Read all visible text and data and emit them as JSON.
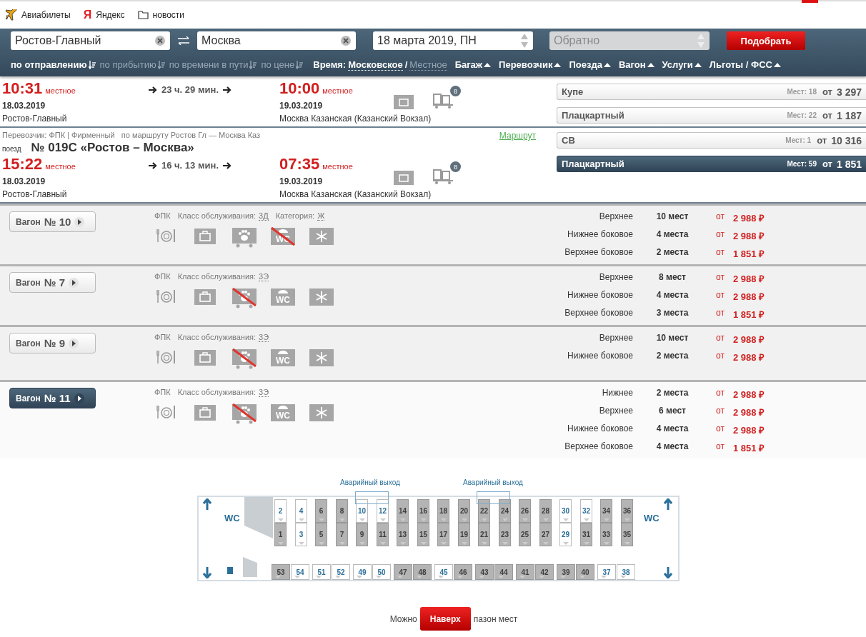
{
  "bookmarks": [
    {
      "kind": "plane",
      "label": "Авиабилеты"
    },
    {
      "kind": "yandex",
      "logo": "Я",
      "label": "Яндекс"
    },
    {
      "kind": "folder",
      "label": "новости"
    }
  ],
  "search": {
    "from": "Ростов-Главный",
    "to": "Москва",
    "date": "18 марта 2019, ПН",
    "return_placeholder": "Обратно",
    "submit": "Подобрать"
  },
  "sort_options": [
    {
      "label": "по отправлению",
      "selected": true
    },
    {
      "label": "по прибытию",
      "selected": false
    },
    {
      "label": "по времени в пути",
      "selected": false
    },
    {
      "label": "по цене",
      "selected": false
    }
  ],
  "time": {
    "label": "Время:",
    "separator": "/",
    "options": [
      {
        "label": "Московское",
        "selected": true
      },
      {
        "label": "Местное",
        "selected": false
      }
    ]
  },
  "filters": [
    "Багаж",
    "Перевозчик",
    "Поезда",
    "Вагон",
    "Услуги",
    "Льготы / ФСС"
  ],
  "trains": [
    {
      "departure": {
        "time": "10:31",
        "zone": "местное",
        "date": "18.03.2019",
        "station": "Ростов-Главный"
      },
      "duration": "23 ч. 29 мин.",
      "arrival": {
        "time": "10:00",
        "zone": "местное",
        "date": "19.03.2019",
        "station": "Москва Казанская (Казанский Вокзал)"
      },
      "wagons_badge": "8",
      "classes": [
        {
          "name": "Купе",
          "seats": "Мест: 18",
          "from": "от",
          "price": "3 297",
          "selected": false
        },
        {
          "name": "Плацкартный",
          "seats": "Мест: 22",
          "from": "от",
          "price": "1 187",
          "selected": false
        }
      ]
    },
    {
      "carrier": "Перевозчик: ФПК | Фирменный",
      "route": "по маршруту Ростов Гл — Москва Каз",
      "route_link": "Маршрут",
      "train_label": "поезд",
      "train_name": "№ 019С «Ростов – Москва»",
      "departure": {
        "time": "15:22",
        "zone": "местное",
        "date": "18.03.2019",
        "station": "Ростов-Главный"
      },
      "duration": "16 ч. 13 мин.",
      "arrival": {
        "time": "07:35",
        "zone": "местное",
        "date": "19.03.2019",
        "station": "Москва Казанская (Казанский Вокзал)"
      },
      "wagons_badge": "8",
      "classes": [
        {
          "name": "СВ",
          "seats": "Мест: 1",
          "from": "от",
          "price": "10 316",
          "selected": false
        },
        {
          "name": "Плацкартный",
          "seats": "Мест: 59",
          "from": "от",
          "price": "1 851",
          "selected": true
        }
      ]
    }
  ],
  "wagons": [
    {
      "label": "Вагон",
      "number": "№ 10",
      "selected": false,
      "carrier": "ФПК",
      "service_label": "Класс обслуживания:",
      "service": "3Д",
      "category_label": "Категория:",
      "category": "Ж",
      "amenities": [
        {
          "kind": "food",
          "available": true
        },
        {
          "kind": "luggage",
          "available": true
        },
        {
          "kind": "pets",
          "available": true
        },
        {
          "kind": "wc",
          "text": "WC",
          "available": false
        },
        {
          "kind": "ac",
          "available": true
        }
      ],
      "seats": [
        {
          "type": "Верхнее",
          "count": "10 мест",
          "from": "от",
          "price": "2 988 ₽"
        },
        {
          "type": "Нижнее боковое",
          "count": "4 места",
          "from": "от",
          "price": "2 988 ₽"
        },
        {
          "type": "Верхнее боковое",
          "count": "2 места",
          "from": "от",
          "price": "1 851 ₽"
        }
      ]
    },
    {
      "label": "Вагон",
      "number": "№ 7",
      "selected": false,
      "carrier": "ФПК",
      "service_label": "Класс обслуживания:",
      "service": "3Э",
      "amenities": [
        {
          "kind": "food",
          "available": true
        },
        {
          "kind": "luggage",
          "available": true
        },
        {
          "kind": "pets",
          "available": false
        },
        {
          "kind": "wc",
          "text": "WC",
          "available": true
        },
        {
          "kind": "ac",
          "available": true
        }
      ],
      "seats": [
        {
          "type": "Верхнее",
          "count": "8 мест",
          "from": "от",
          "price": "2 988 ₽"
        },
        {
          "type": "Нижнее боковое",
          "count": "4 места",
          "from": "от",
          "price": "2 988 ₽"
        },
        {
          "type": "Верхнее боковое",
          "count": "3 места",
          "from": "от",
          "price": "1 851 ₽"
        }
      ]
    },
    {
      "label": "Вагон",
      "number": "№ 9",
      "selected": false,
      "carrier": "ФПК",
      "service_label": "Класс обслуживания:",
      "service": "3Э",
      "amenities": [
        {
          "kind": "food",
          "available": true
        },
        {
          "kind": "luggage",
          "available": true
        },
        {
          "kind": "pets",
          "available": false
        },
        {
          "kind": "wc",
          "text": "WC",
          "available": true
        },
        {
          "kind": "ac",
          "available": true
        }
      ],
      "seats": [
        {
          "type": "Верхнее",
          "count": "10 мест",
          "from": "от",
          "price": "2 988 ₽"
        },
        {
          "type": "Нижнее боковое",
          "count": "2 места",
          "from": "от",
          "price": "2 988 ₽"
        }
      ]
    },
    {
      "label": "Вагон",
      "number": "№ 11",
      "selected": true,
      "carrier": "ФПК",
      "service_label": "Класс обслуживания:",
      "service": "3Э",
      "amenities": [
        {
          "kind": "food",
          "available": true
        },
        {
          "kind": "luggage",
          "available": true
        },
        {
          "kind": "pets",
          "available": false
        },
        {
          "kind": "wc",
          "text": "WC",
          "available": true
        },
        {
          "kind": "ac",
          "available": true
        }
      ],
      "seats": [
        {
          "type": "Нижнее",
          "count": "2 места",
          "from": "от",
          "price": "2 988 ₽"
        },
        {
          "type": "Верхнее",
          "count": "6 мест",
          "from": "от",
          "price": "2 988 ₽"
        },
        {
          "type": "Нижнее боковое",
          "count": "4 места",
          "from": "от",
          "price": "2 988 ₽"
        },
        {
          "type": "Верхнее боковое",
          "count": "4 места",
          "from": "от",
          "price": "1 851 ₽"
        }
      ]
    }
  ],
  "seat_map": {
    "exit_labels": [
      "Аварийный выход",
      "Аварийный выход"
    ],
    "wc": [
      "WC",
      "WC"
    ],
    "compartments": [
      {
        "seats": [
          {
            "number": "2",
            "free": true
          },
          {
            "number": "1",
            "free": false
          },
          {
            "number": "4",
            "free": true
          },
          {
            "number": "3",
            "free": true
          }
        ]
      },
      {
        "seats": [
          {
            "number": "6",
            "free": false
          },
          {
            "number": "5",
            "free": false
          },
          {
            "number": "8",
            "free": false
          },
          {
            "number": "7",
            "free": false
          }
        ]
      },
      {
        "seats": [
          {
            "number": "10",
            "free": true
          },
          {
            "number": "9",
            "free": false
          },
          {
            "number": "12",
            "free": true
          },
          {
            "number": "11",
            "free": false
          }
        ]
      },
      {
        "seats": [
          {
            "number": "14",
            "free": false
          },
          {
            "number": "13",
            "free": false
          },
          {
            "number": "16",
            "free": false
          },
          {
            "number": "15",
            "free": false
          }
        ]
      },
      {
        "seats": [
          {
            "number": "18",
            "free": false
          },
          {
            "number": "17",
            "free": false
          },
          {
            "number": "20",
            "free": false
          },
          {
            "number": "19",
            "free": false
          }
        ]
      },
      {
        "seats": [
          {
            "number": "22",
            "free": false
          },
          {
            "number": "21",
            "free": false
          },
          {
            "number": "24",
            "free": false
          },
          {
            "number": "23",
            "free": false
          }
        ]
      },
      {
        "seats": [
          {
            "number": "26",
            "free": false
          },
          {
            "number": "25",
            "free": false
          },
          {
            "number": "28",
            "free": false
          },
          {
            "number": "27",
            "free": false
          }
        ]
      },
      {
        "seats": [
          {
            "number": "30",
            "free": true
          },
          {
            "number": "29",
            "free": true
          },
          {
            "number": "32",
            "free": true
          },
          {
            "number": "31",
            "free": false
          }
        ]
      },
      {
        "seats": [
          {
            "number": "34",
            "free": false
          },
          {
            "number": "33",
            "free": false
          },
          {
            "number": "36",
            "free": false
          },
          {
            "number": "35",
            "free": false
          }
        ]
      }
    ],
    "side": [
      {
        "seats": [
          {
            "number": "53",
            "free": false
          },
          {
            "number": "54",
            "free": true
          }
        ]
      },
      {
        "seats": [
          {
            "number": "51",
            "free": true
          },
          {
            "number": "52",
            "free": true
          }
        ]
      },
      {
        "seats": [
          {
            "number": "49",
            "free": true
          },
          {
            "number": "50",
            "free": true
          }
        ]
      },
      {
        "seats": [
          {
            "number": "47",
            "free": false
          },
          {
            "number": "48",
            "free": false
          }
        ]
      },
      {
        "seats": [
          {
            "number": "45",
            "free": true
          },
          {
            "number": "46",
            "free": false
          }
        ]
      },
      {
        "seats": [
          {
            "number": "43",
            "free": false
          },
          {
            "number": "44",
            "free": false
          }
        ]
      },
      {
        "seats": [
          {
            "number": "41",
            "free": false
          },
          {
            "number": "42",
            "free": false
          }
        ]
      },
      {
        "seats": [
          {
            "number": "39",
            "free": false
          },
          {
            "number": "40",
            "free": false
          }
        ]
      },
      {
        "seats": [
          {
            "number": "37",
            "free": true
          },
          {
            "number": "38",
            "free": true
          }
        ]
      }
    ]
  },
  "footer": {
    "text_before": "Можно",
    "button": "Наверх",
    "text_after": "пазон мест"
  }
}
